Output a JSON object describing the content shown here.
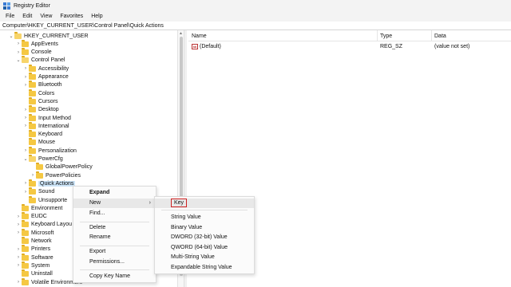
{
  "window": {
    "title": "Registry Editor"
  },
  "menubar": [
    "File",
    "Edit",
    "View",
    "Favorites",
    "Help"
  ],
  "address": "Computer\\HKEY_CURRENT_USER\\Control Panel\\Quick Actions",
  "tree": [
    {
      "label": "HKEY_CURRENT_USER",
      "level": 0,
      "chev": "down",
      "open": true
    },
    {
      "label": "AppEvents",
      "level": 1,
      "chev": "right"
    },
    {
      "label": "Console",
      "level": 1,
      "chev": "right"
    },
    {
      "label": "Control Panel",
      "level": 1,
      "chev": "down",
      "open": true
    },
    {
      "label": "Accessibility",
      "level": 2,
      "chev": "right"
    },
    {
      "label": "Appearance",
      "level": 2,
      "chev": "right"
    },
    {
      "label": "Bluetooth",
      "level": 2,
      "chev": "right"
    },
    {
      "label": "Colors",
      "level": 2,
      "chev": "none"
    },
    {
      "label": "Cursors",
      "level": 2,
      "chev": "none"
    },
    {
      "label": "Desktop",
      "level": 2,
      "chev": "right"
    },
    {
      "label": "Input Method",
      "level": 2,
      "chev": "right"
    },
    {
      "label": "International",
      "level": 2,
      "chev": "right"
    },
    {
      "label": "Keyboard",
      "level": 2,
      "chev": "none"
    },
    {
      "label": "Mouse",
      "level": 2,
      "chev": "none"
    },
    {
      "label": "Personalization",
      "level": 2,
      "chev": "right"
    },
    {
      "label": "PowerCfg",
      "level": 2,
      "chev": "down",
      "open": true
    },
    {
      "label": "GlobalPowerPolicy",
      "level": 3,
      "chev": "none"
    },
    {
      "label": "PowerPolicies",
      "level": 3,
      "chev": "right"
    },
    {
      "label": "Quick Actions",
      "level": 2,
      "chev": "right",
      "selected": true
    },
    {
      "label": "Sound",
      "level": 2,
      "chev": "right"
    },
    {
      "label": "Unsupporte",
      "level": 2,
      "chev": "none"
    },
    {
      "label": "Environment",
      "level": 1,
      "chev": "none"
    },
    {
      "label": "EUDC",
      "level": 1,
      "chev": "right"
    },
    {
      "label": "Keyboard Layou",
      "level": 1,
      "chev": "right"
    },
    {
      "label": "Microsoft",
      "level": 1,
      "chev": "right"
    },
    {
      "label": "Network",
      "level": 1,
      "chev": "none"
    },
    {
      "label": "Printers",
      "level": 1,
      "chev": "right"
    },
    {
      "label": "Software",
      "level": 1,
      "chev": "right"
    },
    {
      "label": "System",
      "level": 1,
      "chev": "right"
    },
    {
      "label": "Uninstall",
      "level": 1,
      "chev": "none"
    },
    {
      "label": "Volatile Environment",
      "level": 1,
      "chev": "right"
    }
  ],
  "list": {
    "headers": [
      "Name",
      "Type",
      "Data"
    ],
    "rows": [
      {
        "name": "(Default)",
        "type": "REG_SZ",
        "data": "(value not set)"
      }
    ]
  },
  "context_menu": [
    "Expand",
    "New",
    "Find...",
    "Delete",
    "Rename",
    "Export",
    "Permissions...",
    "Copy Key Name"
  ],
  "submenu": [
    "Key",
    "String Value",
    "Binary Value",
    "DWORD (32-bit) Value",
    "QWORD (64-bit) Value",
    "Multi-String Value",
    "Expandable String Value"
  ]
}
